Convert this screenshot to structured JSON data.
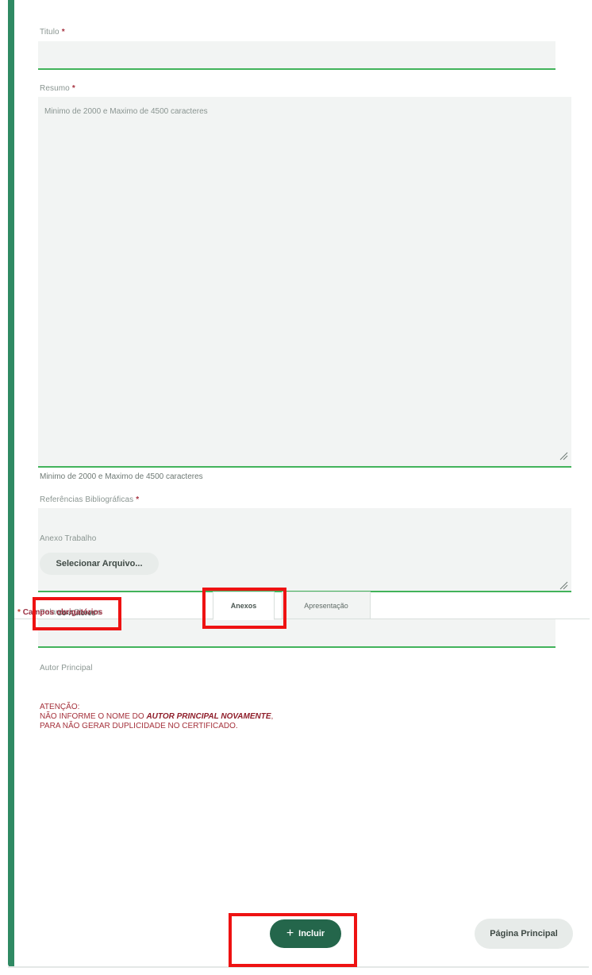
{
  "form": {
    "titulo": {
      "label": "Titulo",
      "required_mark": "*",
      "value": ""
    },
    "resumo": {
      "label": "Resumo",
      "required_mark": "*",
      "value": "",
      "placeholder": "Minimo de 2000 e Maximo de 4500 caracteres",
      "hint": "Minimo de 2000 e Maximo de 4500 caracteres"
    },
    "referencias": {
      "label": "Referências Bibliográficas",
      "required_mark": "*",
      "value": ""
    },
    "palavras_chaves": {
      "label": "Palavras Chaves",
      "value": ""
    },
    "autor_principal": {
      "label": "Autor Principal"
    }
  },
  "warning": {
    "line1": "ATENÇÃO:",
    "line2_prefix": "NÃO INFORME O NOME DO ",
    "line2_emph": "AUTOR PRINCIPAL NOVAMENTE",
    "line2_suffix": ",",
    "line3": "PARA NÃO GERAR DUPLICIDADE NO CERTIFICADO."
  },
  "tabs": [
    {
      "label": "Co-Autores",
      "state": "plain"
    },
    {
      "label": "Anexos",
      "state": "active"
    },
    {
      "label": "Apresentação",
      "state": "inactive"
    }
  ],
  "anexos": {
    "label": "Anexo Trabalho",
    "select_button": "Selecionar Arquivo..."
  },
  "footer": {
    "required_star": "*",
    "required_note": "Campos obrigatórios",
    "include_button": "Incluir",
    "main_page_button": "Página Principal"
  },
  "icons": {
    "include": "plus-icon",
    "textarea_grip": "resize-handle-icon"
  },
  "colors": {
    "accent_green": "#2f8a63",
    "input_underline": "#42b35b",
    "primary_button": "#24664b",
    "required": "#a63240",
    "warning_text": "#a4303a",
    "highlight_box": "#ee1212"
  }
}
